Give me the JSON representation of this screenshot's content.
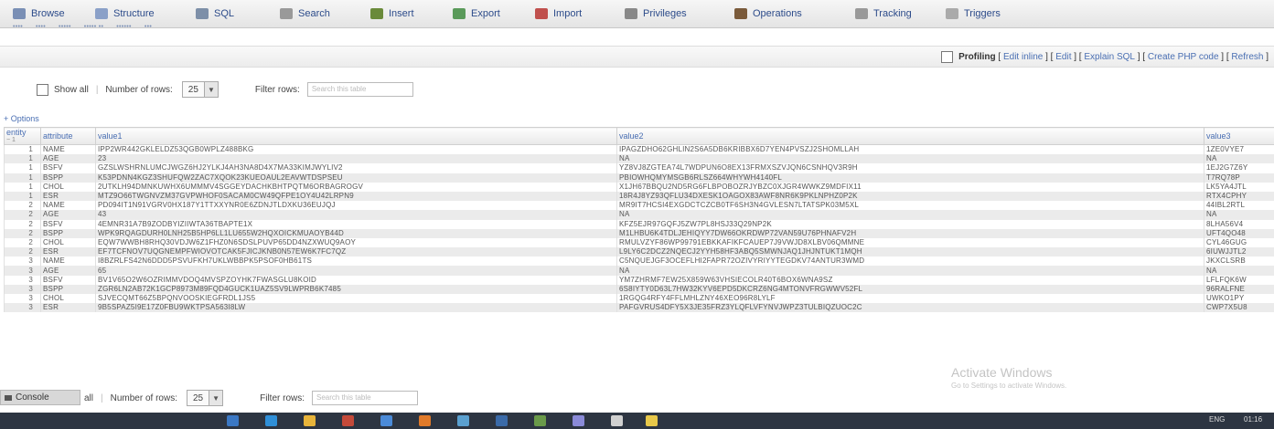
{
  "tabs": [
    {
      "label": "Browse",
      "icon": "browse-icon",
      "color": "#7a8fb5"
    },
    {
      "label": "Structure",
      "icon": "structure-icon",
      "color": "#8aa0c8"
    },
    {
      "label": "SQL",
      "icon": "sql-icon",
      "color": "#7d8fa8"
    },
    {
      "label": "Search",
      "icon": "search-icon",
      "color": "#999999"
    },
    {
      "label": "Insert",
      "icon": "insert-icon",
      "color": "#6a8a3a"
    },
    {
      "label": "Export",
      "icon": "export-icon",
      "color": "#5a9a5a"
    },
    {
      "label": "Import",
      "icon": "import-icon",
      "color": "#c0504d"
    },
    {
      "label": "Privileges",
      "icon": "privileges-icon",
      "color": "#888888"
    },
    {
      "label": "Operations",
      "icon": "operations-icon",
      "color": "#7a5a3a"
    },
    {
      "label": "Tracking",
      "icon": "tracking-icon",
      "color": "#999999"
    },
    {
      "label": "Triggers",
      "icon": "triggers-icon",
      "color": "#aaaaaa"
    }
  ],
  "profiling": {
    "label": "Profiling",
    "links": [
      "Edit inline",
      "Edit",
      "Explain SQL",
      "Create PHP code",
      "Refresh"
    ]
  },
  "controls": {
    "show_all": "Show all",
    "number_of_rows": "Number of rows:",
    "rows_value": "25",
    "filter_rows": "Filter rows:",
    "filter_placeholder": "Search this table"
  },
  "options_link": "+ Options",
  "table": {
    "headers": [
      "entity",
      "attribute",
      "value1",
      "value2",
      "value3"
    ],
    "entity_sub": "− 1",
    "rows": [
      [
        "1",
        "NAME",
        "IPP2WR442GKLELDZ53QGB0WPLZ488BKG",
        "IPAGZDHO62GHLIN2S6A5DB6KRIBBX6D7YEN4PVSZJ2SHOMLLAH",
        "1ZE0VYE7"
      ],
      [
        "1",
        "AGE",
        "23",
        "NA",
        "NA"
      ],
      [
        "1",
        "BSFV",
        "GZSLWSHRNLUMCJWGZ6HJ2YLKJ4AH3NA8D4X7MA33KIMJWYLIV2",
        "YZ8VJ8ZGTEA74L7WDPUN6O8EX13FRMXSZVJQN6CSNHQV3R9H",
        "1EJ2G7Z6Y"
      ],
      [
        "1",
        "BSPP",
        "K53PDNN4KGZ3SHUFQW2ZAC7XQOK23KUEOAUL2EAVWTDSPSEU",
        "PBIOWHQMYMSGB6RLSZ664WHYWH4140FL",
        "T7RQ78P"
      ],
      [
        "1",
        "CHOL",
        "2UTKLH94DMNKUWHX6UMMMV4SGGEYDACHKBHTPQTM6ORBAGROGV",
        "X1JH67BBQU2ND5RG6FLBPOBOZRJYBZC0XJGR4WWKZ9MDFIX11",
        "LK5YA4JTL"
      ],
      [
        "1",
        "ESR",
        "MTZ9O66TWGNVZM37GVPWHOF0SACAM0CW49QFPE1OY4U42LRPN9",
        "18R4J8YZ93QFLU34DXESK1OAGOX83AWF8NR6K9PKLNPHZ0P2K",
        "RTX4CPHY"
      ],
      [
        "2",
        "NAME",
        "PD094IT1N91VGRV0HX187Y1TTXXYNR0E6ZDNJTLDXKU36EUJQJ",
        "MR9IT7HCSI4EXGDCTCZCB0TF6SH3N4GVLESN7LTATSPK03M5XL",
        "44IBL2RTL"
      ],
      [
        "2",
        "AGE",
        "43",
        "NA",
        "NA"
      ],
      [
        "2",
        "BSFV",
        "4EMNR31A7B9ZODBYIZIIWTA36TBAPTE1X",
        "KFZ5EJR97GQFJ5ZW7PL8HSJ33Q29NP2K",
        "8LHA56V4"
      ],
      [
        "2",
        "BSPP",
        "WPK9RQAGDURH0LNH25B5HP6LL1LU655W2HQXOICKMUAOYB44D",
        "M1LHBU6K4TDLJEHIQYY7DW66OKRDWP72VAN59U76PHNAFV2H",
        "UFT4QO48"
      ],
      [
        "2",
        "CHOL",
        "EQW7WWBH8RHQ30VDJW6Z1FHZ0N6SDSLPUVP65DD4NZXWUQ9AOY",
        "RMULVZYF86WP99791EBKKAFIKFCAUEP7J9VWJD8XLBV06QMMNE",
        "CYL46GUG"
      ],
      [
        "2",
        "ESR",
        "EF7TCFNOV7UQGNEMPFWIOVOTCAK5FJICJKNB0N57EW6K7FC7QZ",
        "L9LY6C2DCZ2NQECJ2YYH58HF3ABQ5SMWNJAQ1JHJNTUKT1MQH",
        "6IUWJJTL2"
      ],
      [
        "3",
        "NAME",
        "I8BZRLFS42N6DDD5PSVUFKH7UKLWBBPK5PSOF0HB61TS",
        "C5NQUEJGF3OCEFLHI2FAPR72OZIVYRIYYTEGDKV74ANTUR3WMD",
        "JKXCLSRB"
      ],
      [
        "3",
        "AGE",
        "65",
        "NA",
        "NA"
      ],
      [
        "3",
        "BSFV",
        "BV1V65O2W6OZRIMMVDOQ4MVSPZOYHK7FWASGLU8KOID",
        "YM7ZHRMF7EW25X859W63VHSIECOLR40T6BOX6WNA9SZ",
        "LFLFQK6W"
      ],
      [
        "3",
        "BSPP",
        "ZGR6LN2AB72K1GCP8973M89FQD4GUCK1UAZ5SV9LWPRB6K7485",
        "6S8IYTY0D63L7HW32KYV6EPD5DKCRZ6NG4MTONVFRGWWV52FL",
        "96RALFNE"
      ],
      [
        "3",
        "CHOL",
        "SJVECQMT66Z5BPQNVOOSKIEGFRDL1JS5",
        "1RGQG4RFY4FFLMHLZNY46XEO96R8LYLF",
        "UWKO1PY"
      ],
      [
        "3",
        "ESR",
        "9B5SPAZ5I9E17Z0FBU9WKTPSA563I8LW",
        "PAFGVRUS4DFY5X3JE35FRZ3YLQFLVFYNVJWPZ3TULBIQZUOC2C",
        "CWP7X5U8"
      ]
    ]
  },
  "watermark": {
    "line1": "Activate Windows",
    "line2": "Go to Settings to activate Windows."
  },
  "console": "Console",
  "bottom_controls": {
    "show_all": "all",
    "number_of_rows": "Number of rows:",
    "rows_value": "25",
    "filter_rows": "Filter rows:",
    "filter_placeholder": "Search this table"
  },
  "tray": {
    "lang": "ENG",
    "time": "01:16"
  }
}
